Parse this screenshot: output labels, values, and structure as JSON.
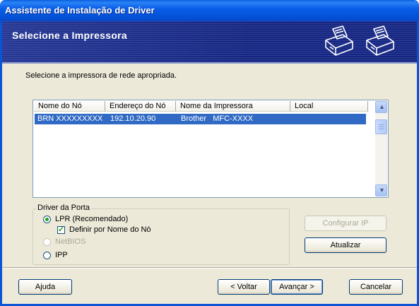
{
  "window": {
    "title": "Assistente de Instalação de Driver",
    "banner_title": "Selecione a Impressora"
  },
  "instruction": "Selecione a impressora de rede apropriada.",
  "printer_list": {
    "columns": [
      "Nome do Nó",
      "Endereço do Nó",
      "Nome da Impressora",
      "Local"
    ],
    "rows": [
      {
        "node_name": "BRN XXXXXXXXX",
        "node_address": "192.10.20.90",
        "printer_name": "Brother   MFC-XXXX",
        "location": "",
        "selected": true
      }
    ]
  },
  "port_driver": {
    "group_label": "Driver da Porta",
    "options": [
      {
        "label": "LPR (Recomendado)",
        "selected": true,
        "enabled": true
      },
      {
        "label": "NetBIOS",
        "selected": false,
        "enabled": false
      },
      {
        "label": "IPP",
        "selected": false,
        "enabled": true
      }
    ],
    "checkbox": {
      "label": "Definir por Nome do Nó",
      "checked": true
    }
  },
  "side_buttons": {
    "configure_ip": "Configurar IP",
    "refresh": "Atualizar"
  },
  "footer": {
    "help": "Ajuda",
    "back": "< Voltar",
    "next": "Avançar >",
    "cancel": "Cancelar"
  },
  "colors": {
    "titlebar": "#0a5ee8",
    "banner": "#1c2f8f",
    "selection": "#316ac5",
    "dialog": "#ece9d8"
  },
  "icons": [
    "printer-icon",
    "printer-icon",
    "scroll-up-icon",
    "scroll-down-icon"
  ]
}
